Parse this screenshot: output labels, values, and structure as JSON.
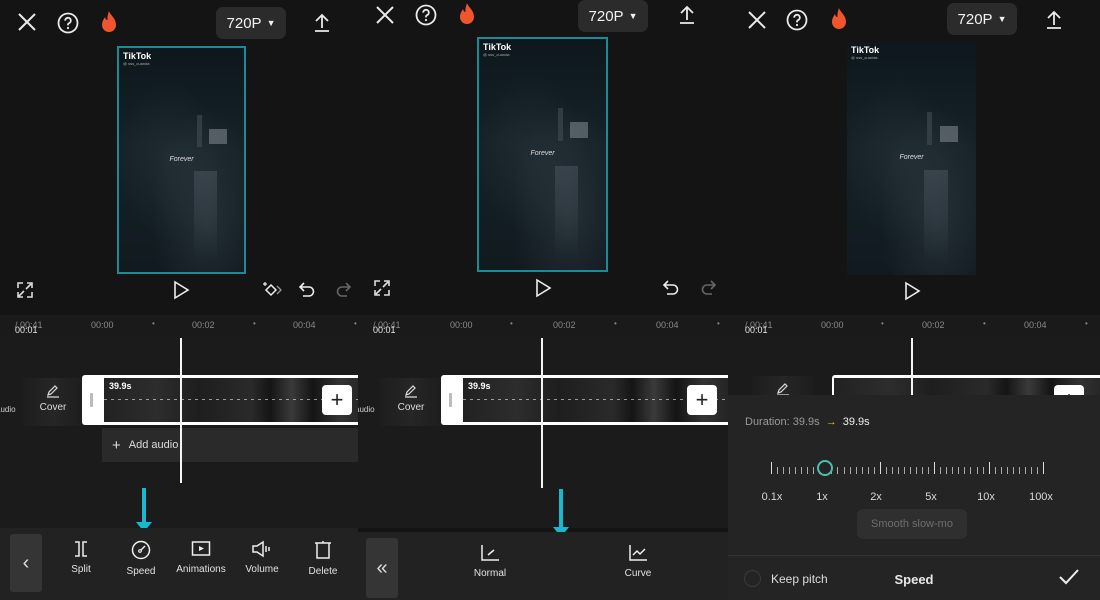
{
  "colors": {
    "accent_cyan": "#19b8cf",
    "selection_border": "#1c8b98",
    "slider_knob": "#4bbfae",
    "duration_arrow": "#f2c318",
    "flame": "#f0552d"
  },
  "top_bar": {
    "resolution": "720P",
    "icons": [
      "close-icon",
      "help-icon",
      "flame-icon",
      "export-icon"
    ]
  },
  "preview": {
    "watermark": "TikTok",
    "watermark_sub": "@ sss_cuanda",
    "overlay_text": "Forever"
  },
  "timeline": {
    "current_time": "00:01",
    "total_time": "/ 00:41",
    "ticks": [
      "00:00",
      "00:02",
      "00:04"
    ],
    "clip_duration": "39.9s",
    "cover_label": "Cover",
    "audio_side_label": "audio",
    "add_audio_label": "Add audio",
    "add_clip_symbol": "+"
  },
  "panel1_toolbar": {
    "back_symbol": "‹",
    "tools": [
      {
        "label": "Split",
        "icon": "split-icon"
      },
      {
        "label": "Speed",
        "icon": "speed-icon"
      },
      {
        "label": "Animations",
        "icon": "animations-icon"
      },
      {
        "label": "Volume",
        "icon": "volume-icon"
      },
      {
        "label": "Delete",
        "icon": "delete-icon"
      }
    ]
  },
  "panel2_toolbar": {
    "back_symbol": "«",
    "tools": [
      {
        "label": "Normal",
        "icon": "normal-speed-icon"
      },
      {
        "label": "Curve",
        "icon": "curve-speed-icon"
      }
    ]
  },
  "speed_panel": {
    "duration_label": "Duration:",
    "duration_from": "39.9s",
    "duration_arrow": "→",
    "duration_to": "39.9s",
    "slider_labels": [
      "0.1x",
      "1x",
      "2x",
      "5x",
      "10x",
      "100x"
    ],
    "current_speed": "1x",
    "smooth_slowmo_label": "Smooth slow-mo",
    "keep_pitch_label": "Keep pitch",
    "keep_pitch_checked": false,
    "title": "Speed"
  }
}
